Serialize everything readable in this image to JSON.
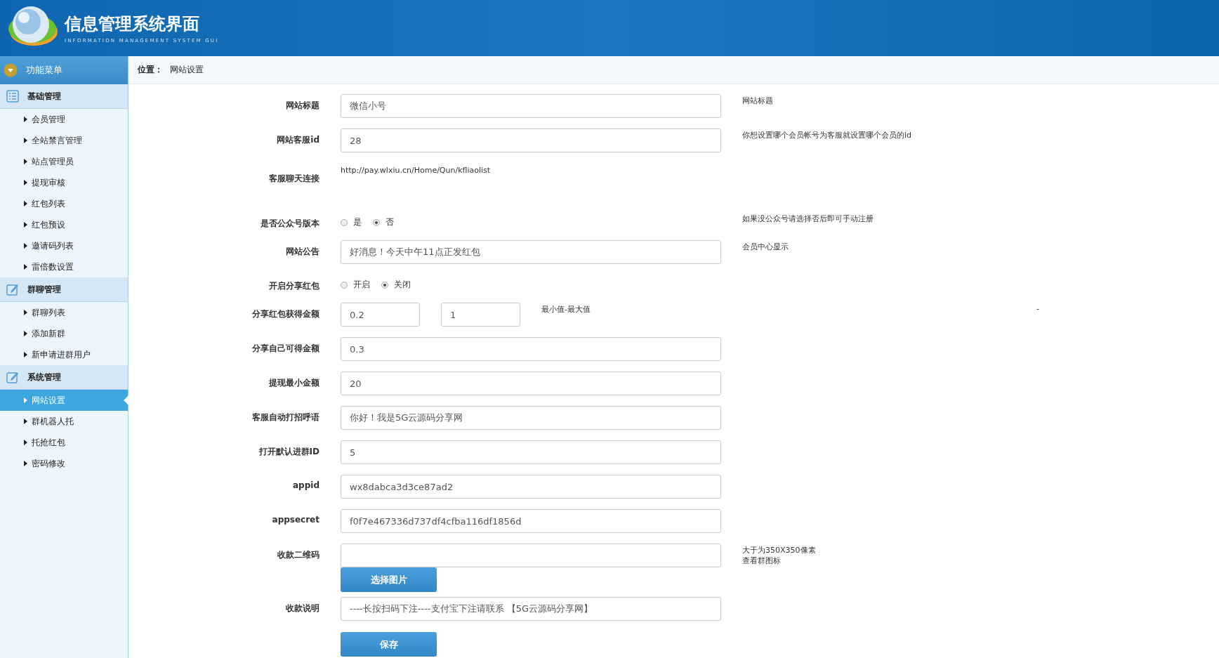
{
  "header": {
    "title": "信息管理系统界面",
    "subtitle": "INFORMATION MANAGEMENT SYSTEM GUI"
  },
  "sidebar": {
    "title": "功能菜单",
    "groups": [
      {
        "title": "基础管理",
        "items": [
          {
            "label": "会员管理",
            "selected": false
          },
          {
            "label": "全站禁言管理",
            "selected": false
          },
          {
            "label": "站点管理员",
            "selected": false
          },
          {
            "label": "提现审核",
            "selected": false
          },
          {
            "label": "红包列表",
            "selected": false
          },
          {
            "label": "红包预设",
            "selected": false
          },
          {
            "label": "邀请码列表",
            "selected": false
          },
          {
            "label": "雷倍数设置",
            "selected": false
          }
        ]
      },
      {
        "title": "群聊管理",
        "items": [
          {
            "label": "群聊列表",
            "selected": false
          },
          {
            "label": "添加新群",
            "selected": false
          },
          {
            "label": "新申请进群用户",
            "selected": false
          }
        ]
      },
      {
        "title": "系统管理",
        "items": [
          {
            "label": "网站设置",
            "selected": true
          },
          {
            "label": "群机器人托",
            "selected": false
          },
          {
            "label": "托抢红包",
            "selected": false
          },
          {
            "label": "密码修改",
            "selected": false
          }
        ]
      }
    ]
  },
  "breadcrumb": {
    "label": "位置：",
    "current": "网站设置"
  },
  "form": {
    "rows": [
      {
        "kind": "text",
        "label": "网站标题",
        "value": "微信小号",
        "note": "网站标题"
      },
      {
        "kind": "text",
        "label": "网站客服id",
        "value": "28",
        "note": "你想设置哪个会员帐号为客服就设置哪个会员的id"
      },
      {
        "kind": "link",
        "label": "客服聊天连接",
        "value": "http://pay.wlxiu.cn/Home/Qun/kfliaolist"
      },
      {
        "kind": "radio",
        "label": "是否公众号版本",
        "options": [
          {
            "label": "是",
            "selected": false
          },
          {
            "label": "否",
            "selected": true
          }
        ],
        "note": "如果没公众号请选择否后即可手动注册"
      },
      {
        "kind": "text",
        "label": "网站公告",
        "value": "好消息！今天中午11点正发红包",
        "note": "会员中心显示"
      },
      {
        "kind": "radio",
        "label": "开启分享红包",
        "options": [
          {
            "label": "开启",
            "selected": false
          },
          {
            "label": "关闭",
            "selected": true
          }
        ]
      },
      {
        "kind": "pair",
        "label": "分享红包获得金额",
        "values": [
          "0.2",
          "1"
        ],
        "note": "最小值-最大值",
        "extra": "-"
      },
      {
        "kind": "text",
        "label": "分享自己可得金额",
        "value": "0.3"
      },
      {
        "kind": "text",
        "label": "提现最小金额",
        "value": "20"
      },
      {
        "kind": "text",
        "label": "客服自动打招呼语",
        "value": "你好！我是5G云源码分享网"
      },
      {
        "kind": "text",
        "label": "打开默认进群ID",
        "value": "5"
      },
      {
        "kind": "text",
        "label": "appid",
        "value": "wx8dabca3d3ce87ad2"
      },
      {
        "kind": "text",
        "label": "appsecret",
        "value": "f0f7e467336d737df4cfba116df1856d"
      },
      {
        "kind": "upload",
        "label": "收款二维码",
        "button": "选择图片",
        "notes": [
          "大于为350X350像素",
          "查看群图标"
        ]
      },
      {
        "kind": "text",
        "label": "收款说明",
        "value": "----长按扫码下注----支付宝下注请联系 【5G云源码分享网】"
      }
    ],
    "save_button": "保存"
  }
}
